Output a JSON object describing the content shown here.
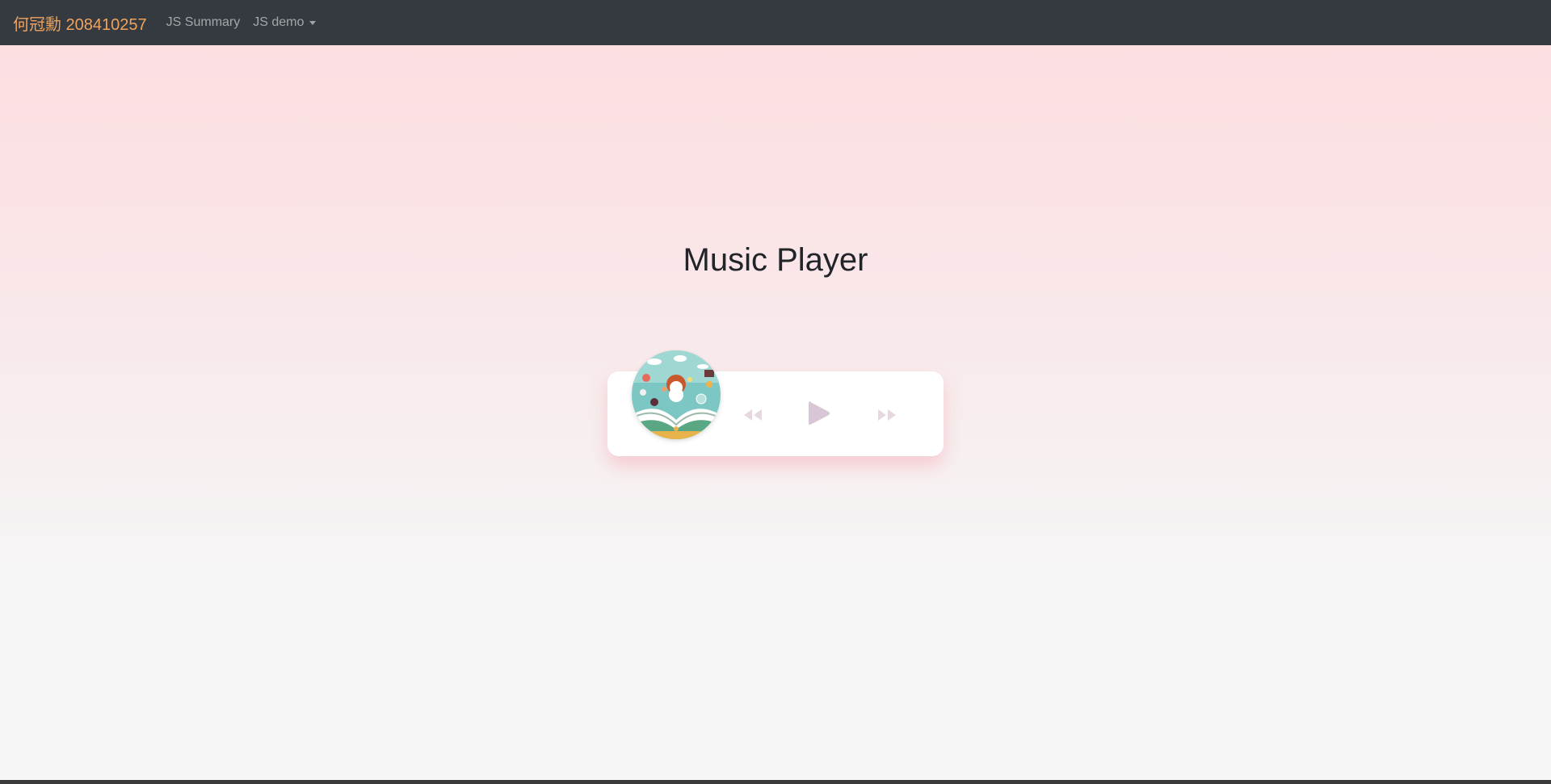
{
  "nav": {
    "brand": "何冠勳 208410257",
    "links": [
      {
        "label": "JS Summary"
      },
      {
        "label": "JS demo"
      }
    ]
  },
  "page": {
    "title": "Music Player"
  },
  "player": {
    "cover_icon": "album-cover-art",
    "controls": {
      "prev_icon": "backward-icon",
      "play_icon": "play-icon",
      "next_icon": "forward-icon"
    }
  },
  "colors": {
    "navbar": "#343a40",
    "brand": "#f0a35e",
    "control": "#d7c9d6"
  }
}
